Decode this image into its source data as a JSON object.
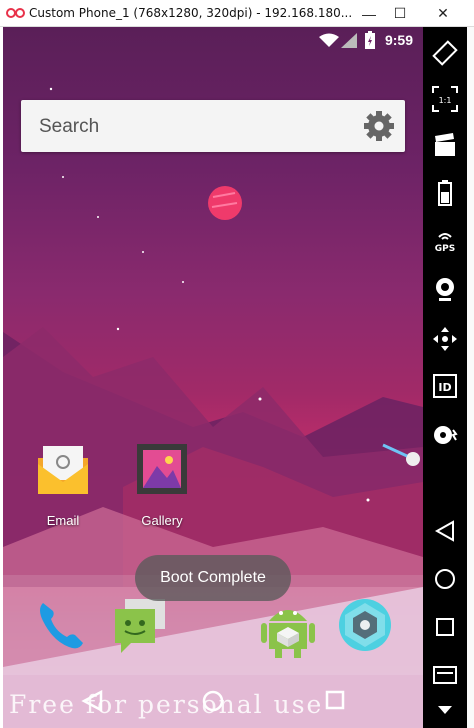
{
  "window": {
    "title": "Custom Phone_1 (768x1280, 320dpi) - 192.168.180...",
    "minimize_glyph": "—",
    "maximize_glyph": "☐",
    "close_glyph": "✕"
  },
  "statusbar": {
    "time": "9:59",
    "icons": [
      "wifi-icon",
      "cell-signal-icon",
      "battery-charging-icon"
    ]
  },
  "search": {
    "placeholder": "Search"
  },
  "apps": [
    {
      "label": "Email",
      "icon": "email-icon"
    },
    {
      "label": "Gallery",
      "icon": "gallery-icon"
    }
  ],
  "dock": {
    "apps": [
      "phone-icon",
      "messaging-icon",
      "android-store-icon",
      "camera-icon"
    ]
  },
  "toast": {
    "text": "Boot Complete"
  },
  "watermark": "Free for personal use",
  "sidebar": {
    "buttons": [
      "rotate-icon",
      "scale-1-1-icon",
      "screen-record-icon",
      "battery-icon",
      "gps-icon",
      "webcam-icon",
      "dpad-icon",
      "id-icon",
      "media-icon",
      "back-icon",
      "home-icon",
      "recents-icon",
      "menu-icon",
      "more-icon"
    ],
    "gps_label": "GPS",
    "scale_label": "1:1",
    "id_label": "ID"
  },
  "colors": {
    "accent": "#c12d6a",
    "toolbar": "#000000"
  }
}
